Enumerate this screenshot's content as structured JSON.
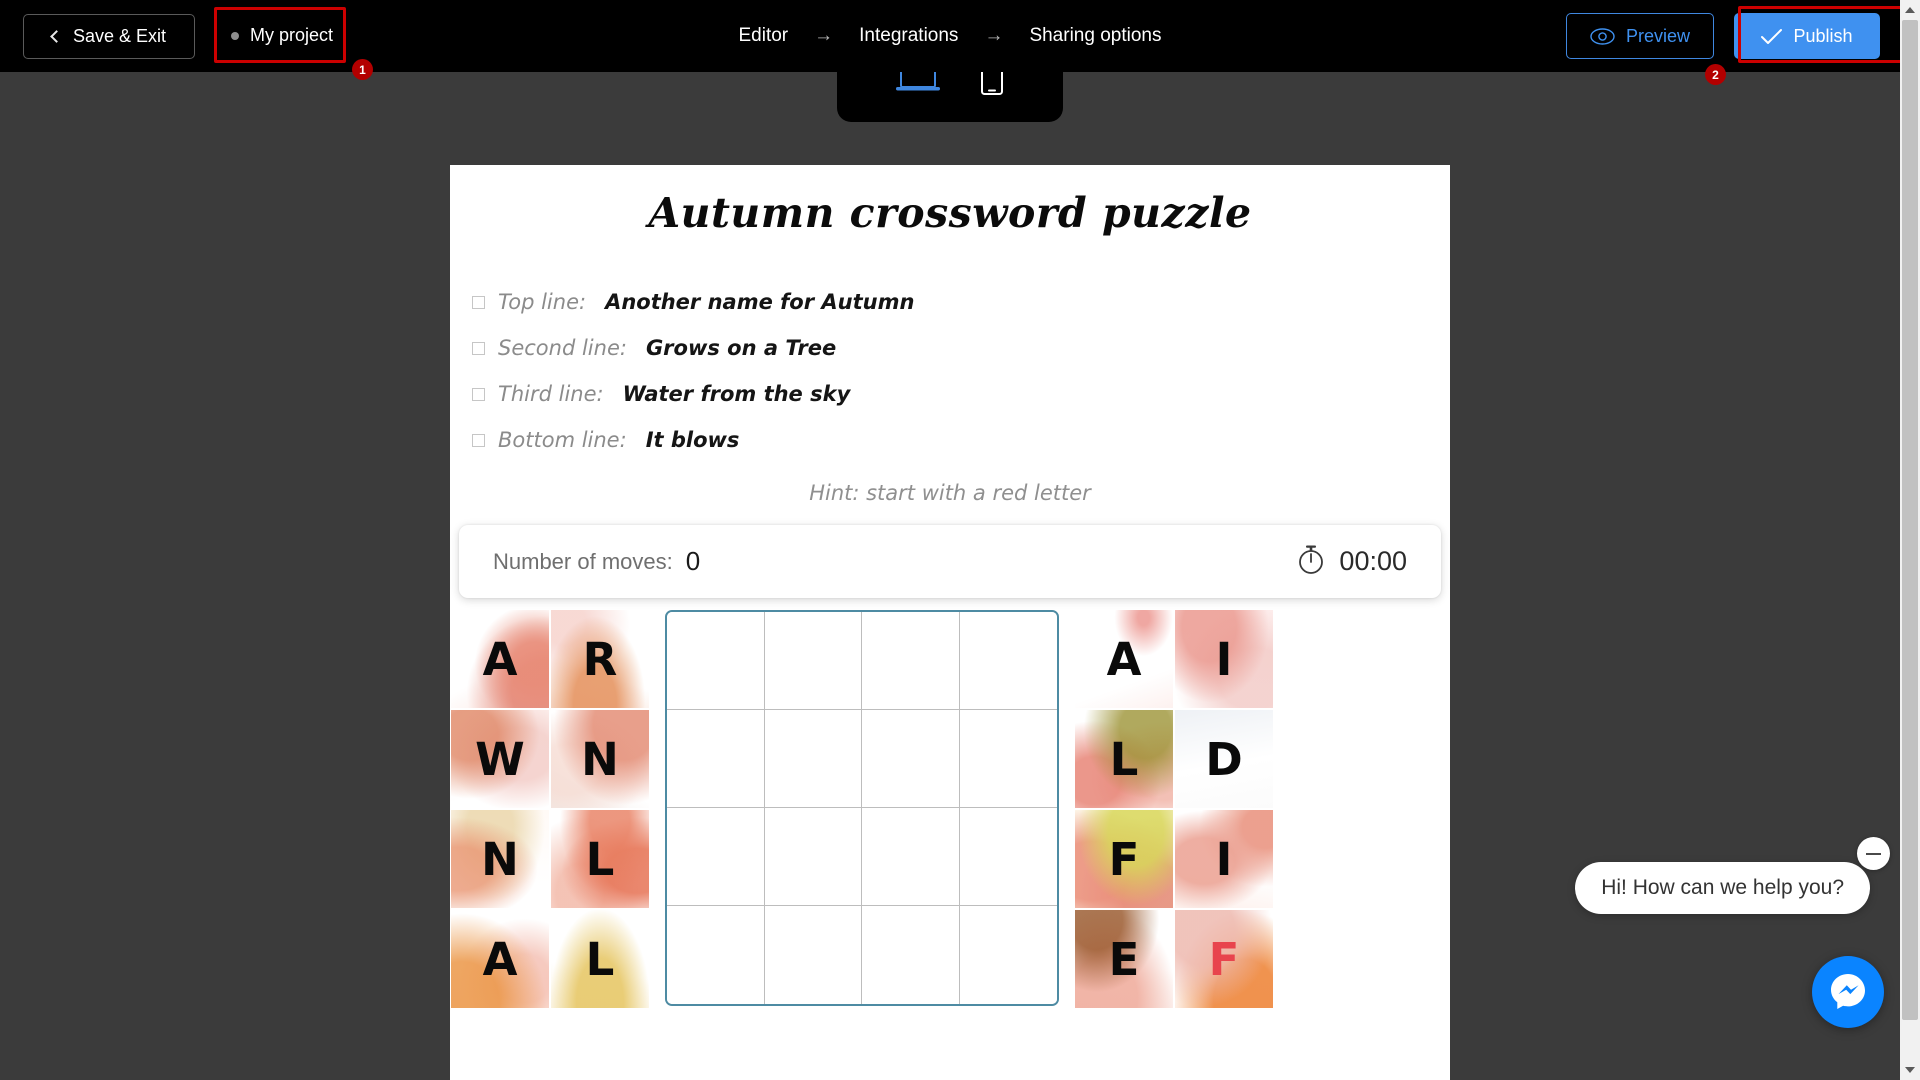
{
  "header": {
    "save_exit_label": "Save & Exit",
    "project_name": "My project",
    "steps": [
      {
        "label": "Editor"
      },
      {
        "label": "Integrations"
      },
      {
        "label": "Sharing options"
      }
    ],
    "step_arrow": "→",
    "preview_label": "Preview",
    "publish_label": "Publish",
    "annotations": [
      {
        "number": "1",
        "target": "project-name"
      },
      {
        "number": "2",
        "target": "publish-button"
      }
    ],
    "accent_blue": "#3f91f0",
    "annotation_red": "#cc0000"
  },
  "device_toggle": {
    "desktop": {
      "name": "desktop-view",
      "active": true,
      "color": "#3f87e0"
    },
    "mobile": {
      "name": "mobile-view",
      "active": false,
      "color": "#ffffff"
    }
  },
  "puzzle": {
    "title": "Autumn crossword puzzle",
    "clues": [
      {
        "label": "Top line:",
        "text": "Another name for Autumn"
      },
      {
        "label": "Second line:",
        "text": "Grows on a Tree"
      },
      {
        "label": "Third line:",
        "text": "Water from the sky"
      },
      {
        "label": "Bottom line:",
        "text": "It blows"
      }
    ],
    "hint": "Hint: start with a red letter",
    "stats": {
      "moves_label": "Number of moves:",
      "moves_value": "0",
      "timer_value": "00:00",
      "timer_icon": "stopwatch-icon"
    },
    "left_tiles": [
      {
        "letter": "A",
        "red": false
      },
      {
        "letter": "R",
        "red": false
      },
      {
        "letter": "W",
        "red": false
      },
      {
        "letter": "N",
        "red": false
      },
      {
        "letter": "N",
        "red": false
      },
      {
        "letter": "L",
        "red": false
      },
      {
        "letter": "A",
        "red": false
      },
      {
        "letter": "L",
        "red": false
      }
    ],
    "right_tiles": [
      {
        "letter": "A",
        "red": false
      },
      {
        "letter": "I",
        "red": false
      },
      {
        "letter": "L",
        "red": false
      },
      {
        "letter": "D",
        "red": false
      },
      {
        "letter": "F",
        "red": false
      },
      {
        "letter": "I",
        "red": false
      },
      {
        "letter": "E",
        "red": false
      },
      {
        "letter": "F",
        "red": true
      }
    ],
    "board": {
      "columns": 4,
      "rows": 4,
      "empty": true,
      "border_color": "#4e8ba3"
    }
  },
  "chat": {
    "greeting": "Hi! How can we help you?",
    "minimize_icon": "minus-icon",
    "fab_icon": "messenger-icon",
    "fab_color": "#0a84ff"
  },
  "scrollbar": {
    "up_icon": "triangle-up-icon",
    "down_icon": "triangle-down-icon"
  }
}
